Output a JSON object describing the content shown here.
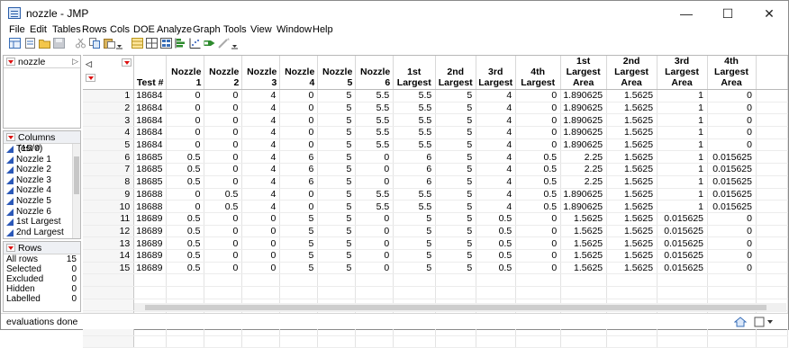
{
  "window": {
    "title": "nozzle - JMP"
  },
  "menu": [
    "File",
    "Edit",
    "Tables",
    "Rows",
    "Cols",
    "DOE",
    "Analyze",
    "Graph",
    "Tools",
    "View",
    "Window",
    "Help"
  ],
  "table_panel": {
    "name": "nozzle"
  },
  "columns_panel": {
    "title": "Columns (15/0)",
    "items": [
      "Test #",
      "Nozzle 1",
      "Nozzle 2",
      "Nozzle 3",
      "Nozzle 4",
      "Nozzle 5",
      "Nozzle 6",
      "1st Largest",
      "2nd Largest"
    ]
  },
  "rows_panel": {
    "title": "Rows",
    "items": [
      {
        "label": "All rows",
        "value": "15"
      },
      {
        "label": "Selected",
        "value": "0"
      },
      {
        "label": "Excluded",
        "value": "0"
      },
      {
        "label": "Hidden",
        "value": "0"
      },
      {
        "label": "Labelled",
        "value": "0"
      }
    ]
  },
  "grid": {
    "headers": [
      [
        "Test #"
      ],
      [
        "Nozzle 1"
      ],
      [
        "Nozzle 2"
      ],
      [
        "Nozzle 3"
      ],
      [
        "Nozzle 4"
      ],
      [
        "Nozzle 5"
      ],
      [
        "Nozzle 6"
      ],
      [
        "1st",
        "Largest"
      ],
      [
        "2nd",
        "Largest"
      ],
      [
        "3rd",
        "Largest"
      ],
      [
        "4th",
        "Largest"
      ],
      [
        "1st Largest",
        "Area"
      ],
      [
        "2nd Largest",
        "Area"
      ],
      [
        "3rd Largest",
        "Area"
      ],
      [
        "4th Largest",
        "Area"
      ]
    ],
    "rows": [
      [
        "18684",
        "0",
        "0",
        "4",
        "0",
        "5",
        "5.5",
        "5.5",
        "5",
        "4",
        "0",
        "1.890625",
        "1.5625",
        "1",
        "0"
      ],
      [
        "18684",
        "0",
        "0",
        "4",
        "0",
        "5",
        "5.5",
        "5.5",
        "5",
        "4",
        "0",
        "1.890625",
        "1.5625",
        "1",
        "0"
      ],
      [
        "18684",
        "0",
        "0",
        "4",
        "0",
        "5",
        "5.5",
        "5.5",
        "5",
        "4",
        "0",
        "1.890625",
        "1.5625",
        "1",
        "0"
      ],
      [
        "18684",
        "0",
        "0",
        "4",
        "0",
        "5",
        "5.5",
        "5.5",
        "5",
        "4",
        "0",
        "1.890625",
        "1.5625",
        "1",
        "0"
      ],
      [
        "18684",
        "0",
        "0",
        "4",
        "0",
        "5",
        "5.5",
        "5.5",
        "5",
        "4",
        "0",
        "1.890625",
        "1.5625",
        "1",
        "0"
      ],
      [
        "18685",
        "0.5",
        "0",
        "4",
        "6",
        "5",
        "0",
        "6",
        "5",
        "4",
        "0.5",
        "2.25",
        "1.5625",
        "1",
        "0.015625"
      ],
      [
        "18685",
        "0.5",
        "0",
        "4",
        "6",
        "5",
        "0",
        "6",
        "5",
        "4",
        "0.5",
        "2.25",
        "1.5625",
        "1",
        "0.015625"
      ],
      [
        "18685",
        "0.5",
        "0",
        "4",
        "6",
        "5",
        "0",
        "6",
        "5",
        "4",
        "0.5",
        "2.25",
        "1.5625",
        "1",
        "0.015625"
      ],
      [
        "18688",
        "0",
        "0.5",
        "4",
        "0",
        "5",
        "5.5",
        "5.5",
        "5",
        "4",
        "0.5",
        "1.890625",
        "1.5625",
        "1",
        "0.015625"
      ],
      [
        "18688",
        "0",
        "0.5",
        "4",
        "0",
        "5",
        "5.5",
        "5.5",
        "5",
        "4",
        "0.5",
        "1.890625",
        "1.5625",
        "1",
        "0.015625"
      ],
      [
        "18689",
        "0.5",
        "0",
        "0",
        "5",
        "5",
        "0",
        "5",
        "5",
        "0.5",
        "0",
        "1.5625",
        "1.5625",
        "0.015625",
        "0"
      ],
      [
        "18689",
        "0.5",
        "0",
        "0",
        "5",
        "5",
        "0",
        "5",
        "5",
        "0.5",
        "0",
        "1.5625",
        "1.5625",
        "0.015625",
        "0"
      ],
      [
        "18689",
        "0.5",
        "0",
        "0",
        "5",
        "5",
        "0",
        "5",
        "5",
        "0.5",
        "0",
        "1.5625",
        "1.5625",
        "0.015625",
        "0"
      ],
      [
        "18689",
        "0.5",
        "0",
        "0",
        "5",
        "5",
        "0",
        "5",
        "5",
        "0.5",
        "0",
        "1.5625",
        "1.5625",
        "0.015625",
        "0"
      ],
      [
        "18689",
        "0.5",
        "0",
        "0",
        "5",
        "5",
        "0",
        "5",
        "5",
        "0.5",
        "0",
        "1.5625",
        "1.5625",
        "0.015625",
        "0"
      ]
    ],
    "row_numbers": [
      "1",
      "2",
      "3",
      "4",
      "5",
      "6",
      "7",
      "8",
      "9",
      "10",
      "11",
      "12",
      "13",
      "14",
      "15"
    ]
  },
  "status": {
    "text": "evaluations done"
  },
  "colors": {
    "accent_red": "#dd1111",
    "column_icon": "#2b58b8"
  }
}
